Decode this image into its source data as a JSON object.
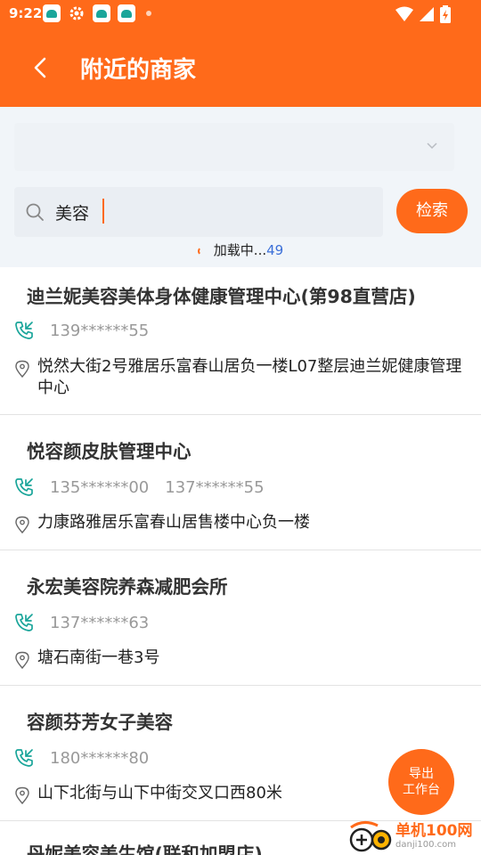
{
  "status": {
    "time": "9:22"
  },
  "header": {
    "title": "附近的商家"
  },
  "search": {
    "value": "美容",
    "button_label": "检索"
  },
  "loading": {
    "text": "加载中...",
    "count": "49"
  },
  "merchants": [
    {
      "name": "迪兰妮美容美体身体健康管理中心(第98直营店)",
      "phones": [
        "139******55"
      ],
      "address": "悦然大街2号雅居乐富春山居负一楼L07整层迪兰妮健康管理中心"
    },
    {
      "name": "悦容颜皮肤管理中心",
      "phones": [
        "135******00",
        "137******55"
      ],
      "address": "力康路雅居乐富春山居售楼中心负一楼"
    },
    {
      "name": "永宏美容院养森减肥会所",
      "phones": [
        "137******63"
      ],
      "address": "塘石南街一巷3号"
    },
    {
      "name": "容颜芬芳女子美容",
      "phones": [
        "180******80"
      ],
      "address": "山下北街与山下中街交叉口西80米"
    },
    {
      "name": "丹妮美容美生馆(联和加盟店)",
      "phones": [],
      "address": ""
    }
  ],
  "float_button": {
    "line1": "导出",
    "line2": "工作台"
  },
  "watermark": {
    "title": "单机100网",
    "url": "danji100.com"
  },
  "colors": {
    "accent": "#ff6a1a",
    "phone_icon": "#1aa59a",
    "link": "#3b6fd8"
  }
}
